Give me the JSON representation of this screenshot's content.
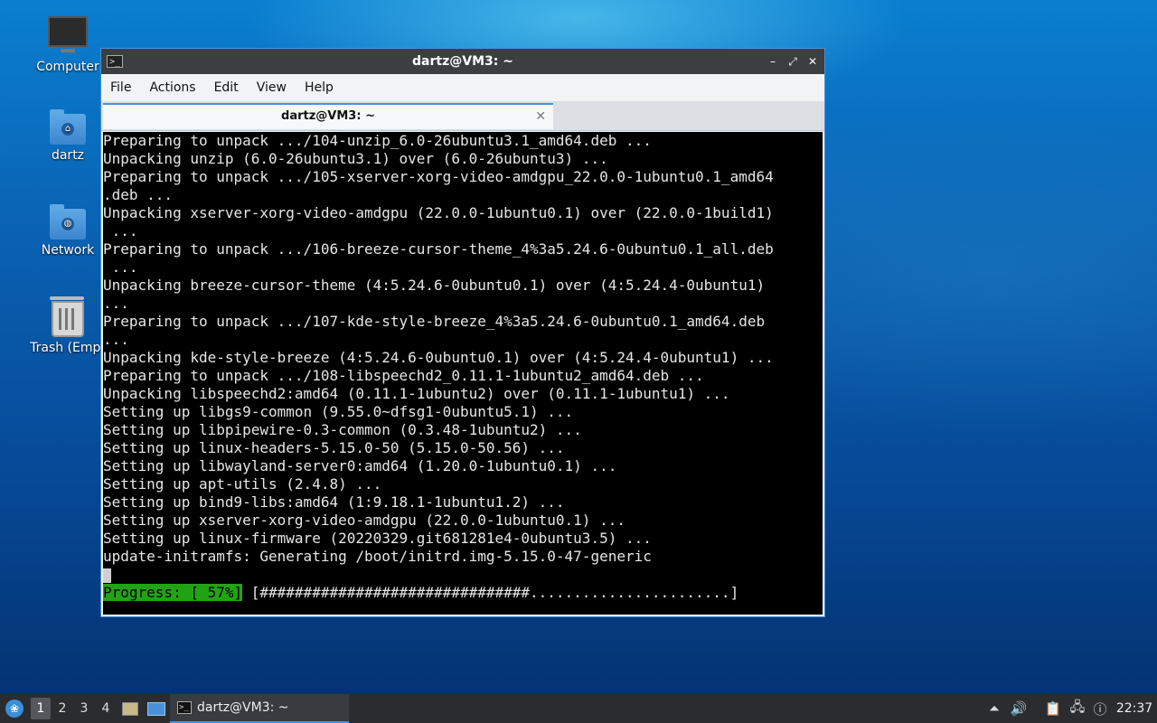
{
  "desktop": {
    "icons": [
      {
        "label": "Computer",
        "icon": "computer-icon"
      },
      {
        "label": "dartz",
        "icon": "home-folder-icon"
      },
      {
        "label": "Network",
        "icon": "network-folder-icon"
      },
      {
        "label": "Trash (Empt",
        "icon": "trash-icon"
      }
    ]
  },
  "window": {
    "title": "dartz@VM3: ~",
    "controls": {
      "minimize": "–",
      "maximize": "⤢",
      "close": "✕"
    },
    "menu": [
      "File",
      "Actions",
      "Edit",
      "View",
      "Help"
    ],
    "tab": {
      "label": "dartz@VM3: ~",
      "close": "✕"
    }
  },
  "terminal": {
    "lines": [
      "Preparing to unpack .../104-unzip_6.0-26ubuntu3.1_amd64.deb ...",
      "Unpacking unzip (6.0-26ubuntu3.1) over (6.0-26ubuntu3) ...",
      "Preparing to unpack .../105-xserver-xorg-video-amdgpu_22.0.0-1ubuntu0.1_amd64",
      ".deb ...",
      "Unpacking xserver-xorg-video-amdgpu (22.0.0-1ubuntu0.1) over (22.0.0-1build1)",
      " ...",
      "Preparing to unpack .../106-breeze-cursor-theme_4%3a5.24.6-0ubuntu0.1_all.deb",
      " ...",
      "Unpacking breeze-cursor-theme (4:5.24.6-0ubuntu0.1) over (4:5.24.4-0ubuntu1)",
      "...",
      "Preparing to unpack .../107-kde-style-breeze_4%3a5.24.6-0ubuntu0.1_amd64.deb",
      "...",
      "Unpacking kde-style-breeze (4:5.24.6-0ubuntu0.1) over (4:5.24.4-0ubuntu1) ...",
      "Preparing to unpack .../108-libspeechd2_0.11.1-1ubuntu2_amd64.deb ...",
      "Unpacking libspeechd2:amd64 (0.11.1-1ubuntu2) over (0.11.1-1ubuntu1) ...",
      "Setting up libgs9-common (9.55.0~dfsg1-0ubuntu5.1) ...",
      "Setting up libpipewire-0.3-common (0.3.48-1ubuntu2) ...",
      "Setting up linux-headers-5.15.0-50 (5.15.0-50.56) ...",
      "Setting up libwayland-server0:amd64 (1.20.0-1ubuntu0.1) ...",
      "Setting up apt-utils (2.4.8) ...",
      "Setting up bind9-libs:amd64 (1:9.18.1-1ubuntu1.2) ...",
      "Setting up xserver-xorg-video-amdgpu (22.0.0-1ubuntu0.1) ...",
      "Setting up linux-firmware (20220329.git681281e4-0ubuntu3.5) ...",
      "update-initramfs: Generating /boot/initrd.img-5.15.0-47-generic"
    ],
    "progress_label": "Progress: [ 57%]",
    "progress_bar": " [###############################.......................]",
    "progress_percent": 57
  },
  "taskbar": {
    "workspaces": [
      "1",
      "2",
      "3",
      "4"
    ],
    "active_workspace": "1",
    "task_label": "dartz@VM3: ~",
    "clock": "22:37"
  },
  "colors": {
    "accent": "#4a90d9",
    "progress_green": "#22a316"
  }
}
